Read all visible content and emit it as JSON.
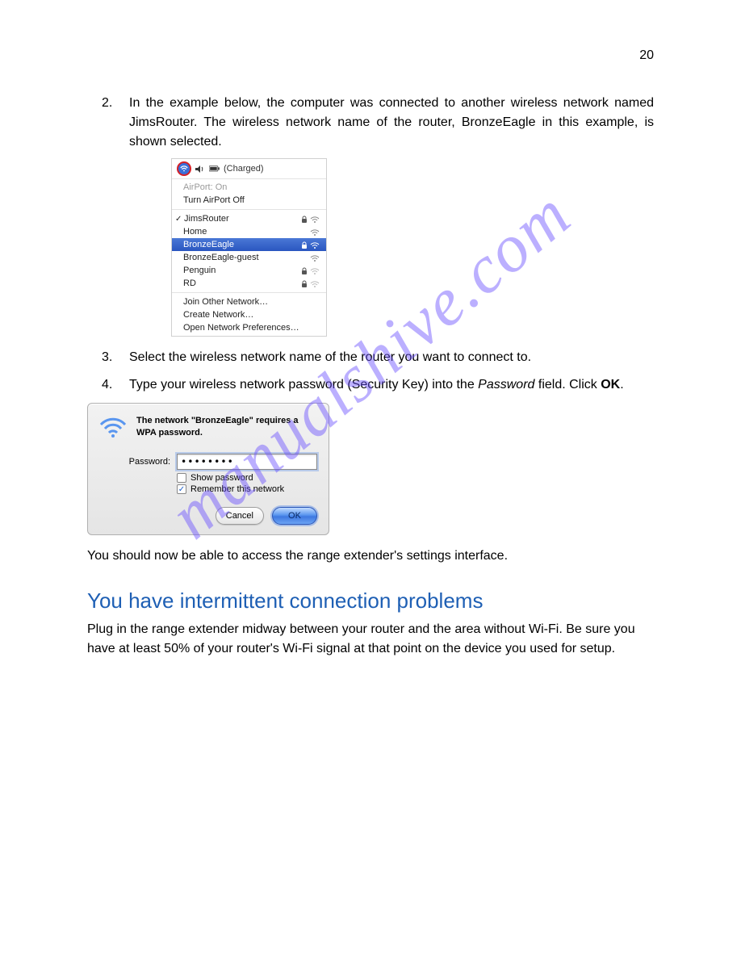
{
  "page_number": "20",
  "watermark": "manualshive.com",
  "steps": [
    {
      "num": "2.",
      "text": "In the example below, the computer was connected to another wireless network named JimsRouter. The wireless network name of the router, BronzeEagle in this example, is shown selected."
    },
    {
      "num": "3.",
      "text": "Select the wireless network name of the router you want to connect to."
    },
    {
      "num": "4.",
      "text_pre": "Type your wireless network password (Security Key) into the ",
      "password_word": "Password",
      "text_mid": " field. Click ",
      "ok_word": "OK",
      "text_post": "."
    }
  ],
  "fig1": {
    "charged": "(Charged)",
    "airport_on": "AirPort: On",
    "turn_off": "Turn AirPort Off",
    "networks": [
      {
        "name": "JimsRouter",
        "checked": true,
        "lock": true,
        "wifi": true,
        "selected": false
      },
      {
        "name": "Home",
        "checked": false,
        "lock": false,
        "wifi": true,
        "selected": false
      },
      {
        "name": "BronzeEagle",
        "checked": false,
        "lock": true,
        "wifi": true,
        "selected": true
      },
      {
        "name": "BronzeEagle-guest",
        "checked": false,
        "lock": false,
        "wifi": true,
        "selected": false
      },
      {
        "name": "Penguin",
        "checked": false,
        "lock": true,
        "wifi": true,
        "selected": false
      },
      {
        "name": "RD",
        "checked": false,
        "lock": true,
        "wifi": true,
        "selected": false
      }
    ],
    "join_other": "Join Other Network…",
    "create_network": "Create Network…",
    "open_prefs": "Open Network Preferences…"
  },
  "fig2": {
    "message": "The network \"BronzeEagle\" requires a WPA password.",
    "password_label": "Password:",
    "password_value": "••••••••",
    "show_password": "Show password",
    "remember": "Remember this network",
    "remember_checked": true,
    "cancel": "Cancel",
    "ok": "OK"
  },
  "after_fig2_text": "You should now be able to access the range extender's settings interface.",
  "section_heading": "You have intermittent connection problems",
  "section_body": "Plug in the range extender midway between your router and the area without Wi-Fi. Be sure you have at least 50% of your router's Wi-Fi signal at that point on the device you used for setup."
}
